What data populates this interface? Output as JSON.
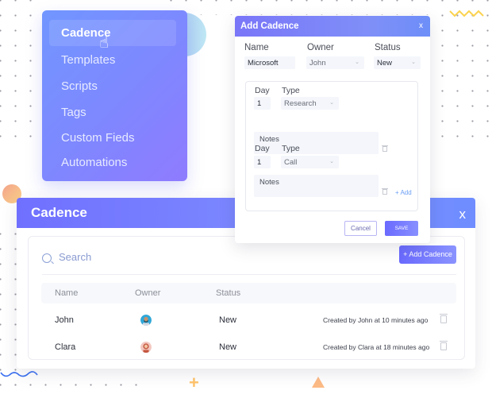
{
  "sidebar": {
    "items": [
      {
        "label": "Cadence",
        "active": true
      },
      {
        "label": "Templates"
      },
      {
        "label": "Scripts"
      },
      {
        "label": "Tags"
      },
      {
        "label": "Custom Fieds"
      },
      {
        "label": "Automations"
      }
    ],
    "cursor_icon": "hand-pointer-icon"
  },
  "modal": {
    "title": "Add Cadence",
    "close_label": "x",
    "name_label": "Name",
    "owner_label": "Owner",
    "status_label": "Status",
    "name_value": "Microsoft",
    "owner_value": "John",
    "status_value": "New",
    "steps": [
      {
        "day_label": "Day",
        "type_label": "Type",
        "day_value": "1",
        "type_value": "Research",
        "notes_placeholder": "Notes"
      },
      {
        "day_label": "Day",
        "type_label": "Type",
        "day_value": "1",
        "type_value": "Call",
        "notes_placeholder": "Notes"
      }
    ],
    "add_label": "+ Add",
    "cancel_label": "Cancel",
    "save_label": "SAVE"
  },
  "panel": {
    "title": "Cadence",
    "close_label": "x",
    "search_placeholder": "Search",
    "add_button_label": "+ Add Cadence",
    "columns": [
      "Name",
      "Owner",
      "Status"
    ],
    "rows": [
      {
        "name": "John",
        "owner_avatar": "avatar-john",
        "status": "New",
        "meta": "Created by John at 10 minutes ago"
      },
      {
        "name": "Clara",
        "owner_avatar": "avatar-clara",
        "status": "New",
        "meta": "Created by Clara at 18 minutes ago"
      }
    ]
  },
  "colors": {
    "accent": "#7a7cff",
    "link": "#6a9ef4"
  }
}
